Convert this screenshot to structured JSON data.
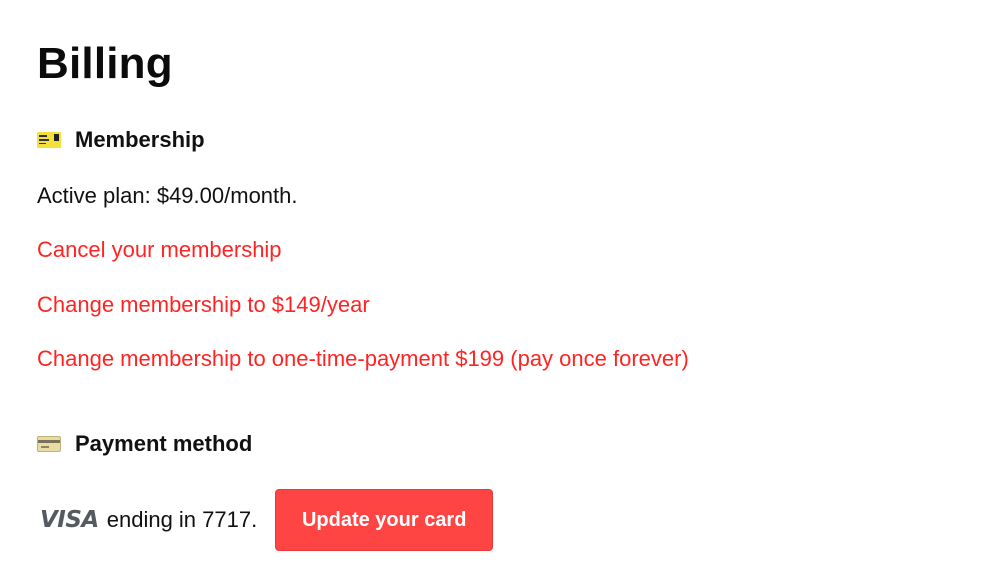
{
  "page": {
    "title": "Billing"
  },
  "membership": {
    "heading": "Membership",
    "icon": "membership-card-icon",
    "plan_text": "Active plan: $49.00/month.",
    "actions": {
      "cancel": "Cancel your membership",
      "yearly": "Change membership to $149/year",
      "one_time": "Change membership to one-time-payment $199 (pay once forever)"
    }
  },
  "payment": {
    "heading": "Payment method",
    "icon": "credit-card-icon",
    "card_brand": "VISA",
    "card_text": "ending in 7717.",
    "update_button": "Update your card"
  },
  "colors": {
    "accent": "#ff2424",
    "button_bg": "#ff4444",
    "text": "#111111"
  }
}
